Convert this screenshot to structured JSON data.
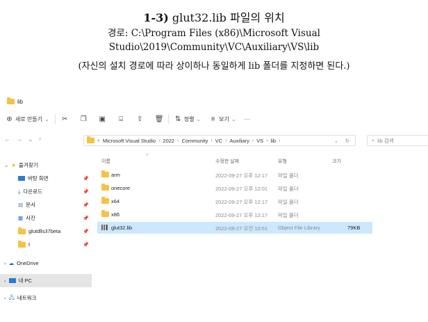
{
  "heading": {
    "num": "1-3)",
    "title": "glut32.lib 파일의 위치",
    "path_line1": "경로: C:\\Program Files (x86)\\Microsoft Visual",
    "path_line2": "Studio\\2019\\Community\\VC\\Auxiliary\\VS\\lib",
    "note": "(자신의 설치 경로에 따라 상이하나 동일하게 lib 폴더를 지정하면 된다.)"
  },
  "window": {
    "title": "lib"
  },
  "commandbar": {
    "new": "새로 만들기",
    "sort": "정렬",
    "view": "보기",
    "more": "···"
  },
  "address": {
    "crumbs": [
      "Microsoft Visual Studio",
      "2022",
      "Community",
      "VC",
      "Auxiliary",
      "VS",
      "lib"
    ],
    "search_placeholder": "lib 검색"
  },
  "sidebar": {
    "quick": "즐겨찾기",
    "items": [
      "바탕 화면",
      "다운로드",
      "문서",
      "사진",
      "glutdlls37beta",
      "t"
    ],
    "onedrive": "OneDrive",
    "thispc": "내 PC",
    "network": "네트워크"
  },
  "columns": {
    "name": "이름",
    "date": "수정한 날짜",
    "type": "유형",
    "size": "크기"
  },
  "files": [
    {
      "name": "arm",
      "date": "2022-09-27 오후 12:17",
      "type": "파일 폴더",
      "size": "",
      "kind": "folder"
    },
    {
      "name": "onecore",
      "date": "2022-09-27 오후 12:01",
      "type": "파일 폴더",
      "size": "",
      "kind": "folder"
    },
    {
      "name": "x64",
      "date": "2022-09-27 오후 12:17",
      "type": "파일 폴더",
      "size": "",
      "kind": "folder"
    },
    {
      "name": "x86",
      "date": "2022-09-27 오후 12:17",
      "type": "파일 폴더",
      "size": "",
      "kind": "folder"
    },
    {
      "name": "glut32.lib",
      "date": "2022-09-27 오전 10:51",
      "type": "Object File Library",
      "size": "79KB",
      "kind": "lib"
    }
  ],
  "colors": {
    "selected_row": "#cce8ff",
    "folder": "#f5c242",
    "accent": "#0067c0"
  }
}
